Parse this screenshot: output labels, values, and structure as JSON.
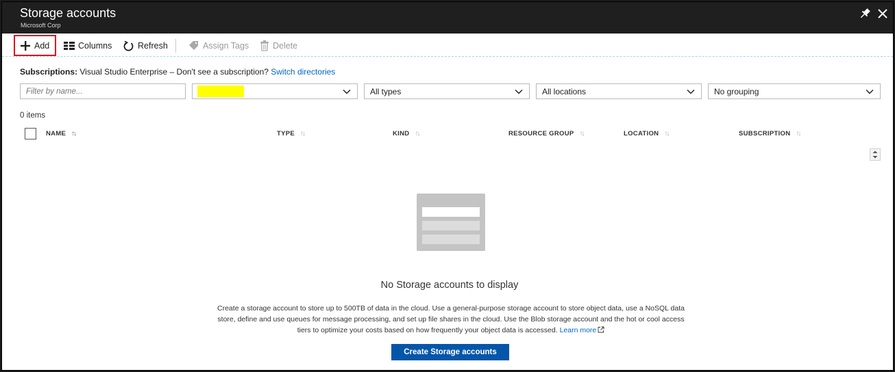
{
  "blade": {
    "title": "Storage accounts",
    "subtitle": "Microsoft Corp"
  },
  "toolbar": {
    "add": "Add",
    "columns": "Columns",
    "refresh": "Refresh",
    "assign_tags": "Assign Tags",
    "delete": "Delete"
  },
  "subscriptions": {
    "label": "Subscriptions:",
    "value": "Visual Studio Enterprise – Don't see a subscription?",
    "link": "Switch directories"
  },
  "filters": {
    "name_placeholder": "Filter by name...",
    "type": "All types",
    "location": "All locations",
    "grouping": "No grouping"
  },
  "item_count": "0 items",
  "columns": [
    "NAME",
    "TYPE",
    "KIND",
    "RESOURCE GROUP",
    "LOCATION",
    "SUBSCRIPTION"
  ],
  "empty_state": {
    "title": "No Storage accounts to display",
    "description": "Create a storage account to store up to 500TB of data in the cloud. Use a general-purpose storage account to store object data, use a NoSQL data store, define and use queues for message processing, and set up file shares in the cloud. Use the Blob storage account and the hot or cool access tiers to optimize your costs based on how frequently your object data is accessed.",
    "learn_more": "Learn more",
    "button": "Create Storage accounts"
  },
  "colors": {
    "header_bg": "#1f1f1f",
    "accent_blue": "#0556a9",
    "link_blue": "#0066c5",
    "highlight_yellow": "#ffff00",
    "add_outline_red": "#e0101a"
  }
}
